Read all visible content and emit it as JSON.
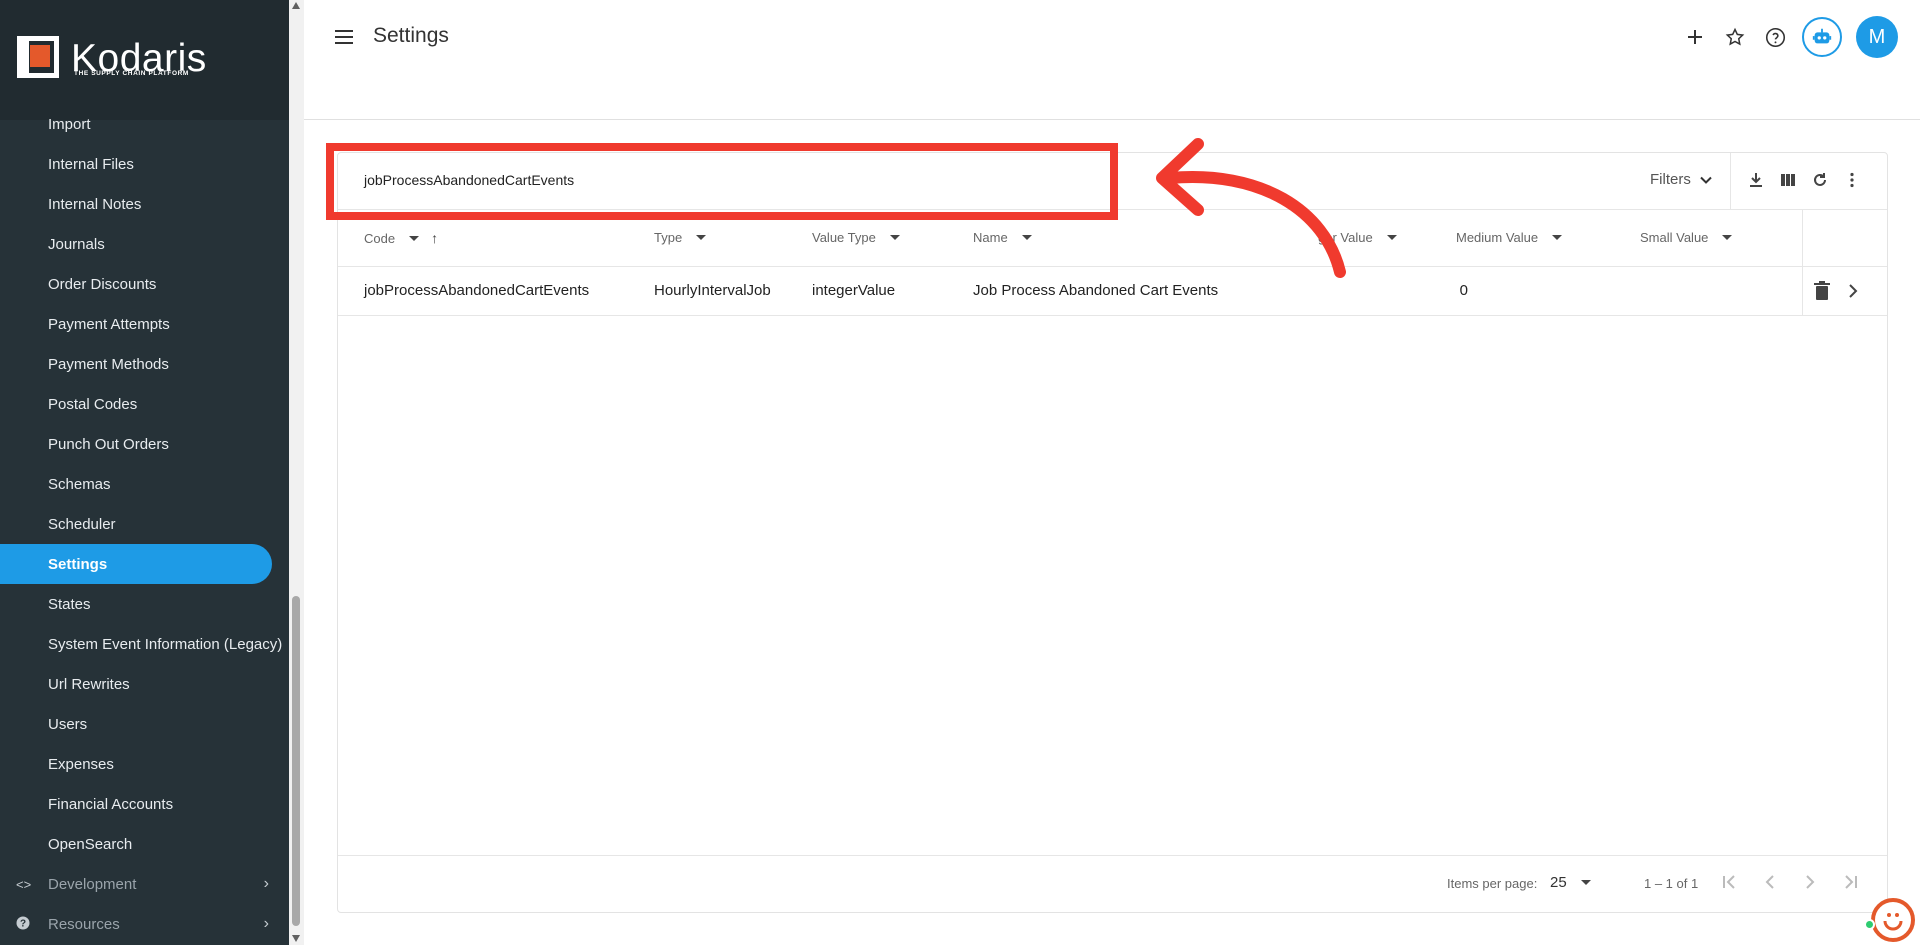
{
  "app": {
    "logo_text": "Kodaris",
    "logo_sub": "THE SUPPLY CHAIN PLATFORM"
  },
  "sidebar": {
    "items": [
      {
        "label": "Import"
      },
      {
        "label": "Internal Files"
      },
      {
        "label": "Internal Notes"
      },
      {
        "label": "Journals"
      },
      {
        "label": "Order Discounts"
      },
      {
        "label": "Payment Attempts"
      },
      {
        "label": "Payment Methods"
      },
      {
        "label": "Postal Codes"
      },
      {
        "label": "Punch Out Orders"
      },
      {
        "label": "Schemas"
      },
      {
        "label": "Scheduler"
      },
      {
        "label": "Settings"
      },
      {
        "label": "States"
      },
      {
        "label": "System Event Information (Legacy)"
      },
      {
        "label": "Url Rewrites"
      },
      {
        "label": "Users"
      },
      {
        "label": "Expenses"
      },
      {
        "label": "Financial Accounts"
      },
      {
        "label": "OpenSearch"
      }
    ],
    "groups": [
      {
        "label": "Development",
        "icon": "code-icon"
      },
      {
        "label": "Resources",
        "icon": "help-circle-icon"
      }
    ],
    "active_color": "#1e9be6"
  },
  "header": {
    "title": "Settings",
    "avatar_initial": "M"
  },
  "search": {
    "value": "jobProcessAbandonedCartEvents"
  },
  "toolbar": {
    "filters_label": "Filters"
  },
  "table": {
    "columns": [
      "Code",
      "Type",
      "Value Type",
      "Name",
      "ger Value",
      "Medium Value",
      "Small Value"
    ],
    "rows": [
      {
        "code": "jobProcessAbandonedCartEvents",
        "type": "HourlyIntervalJob",
        "value_type": "integerValue",
        "name": "Job Process Abandoned Cart Events",
        "integer_value": "0",
        "medium_value": "",
        "small_value": ""
      }
    ]
  },
  "pagination": {
    "items_per_page_label": "Items per page:",
    "items_per_page": "25",
    "range": "1 – 1 of 1"
  },
  "annotation": {
    "color": "#f03a2e"
  }
}
